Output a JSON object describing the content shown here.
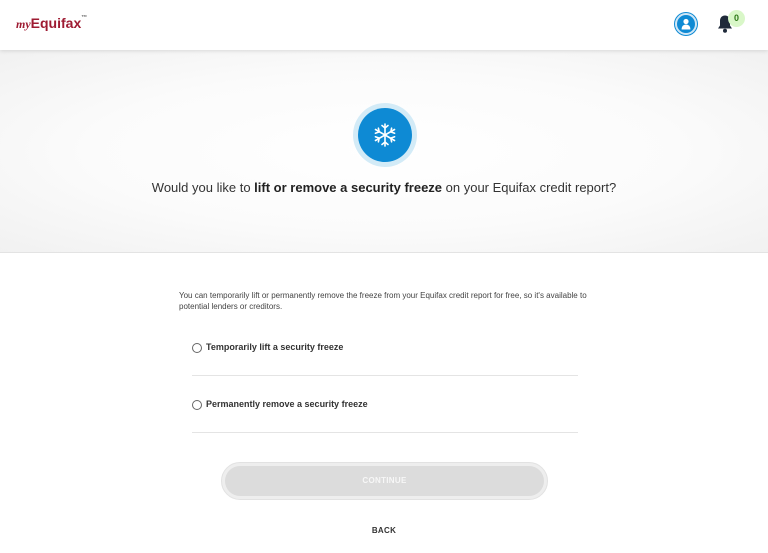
{
  "header": {
    "logo_prefix": "my",
    "logo_name": "Equifax",
    "logo_tm": "™",
    "notification_count": "0",
    "icons": [
      "user-icon",
      "bell-icon"
    ],
    "brand_color": "#9e1b32",
    "accent_color": "#0e8ad4"
  },
  "hero": {
    "icon": "snowflake-icon",
    "question_prefix": "Would you like to ",
    "question_bold": "lift or remove a security freeze",
    "question_suffix": " on your Equifax credit report?"
  },
  "form": {
    "intro": "You can temporarily lift or permanently remove the freeze from your Equifax credit report for free, so it's available to potential lenders or creditors.",
    "options": [
      {
        "label": "Temporarily lift a security freeze",
        "selected": false
      },
      {
        "label": "Permanently remove a security freeze",
        "selected": false
      }
    ],
    "continue_label": "CONTINUE",
    "continue_enabled": false,
    "back_label": "BACK"
  }
}
